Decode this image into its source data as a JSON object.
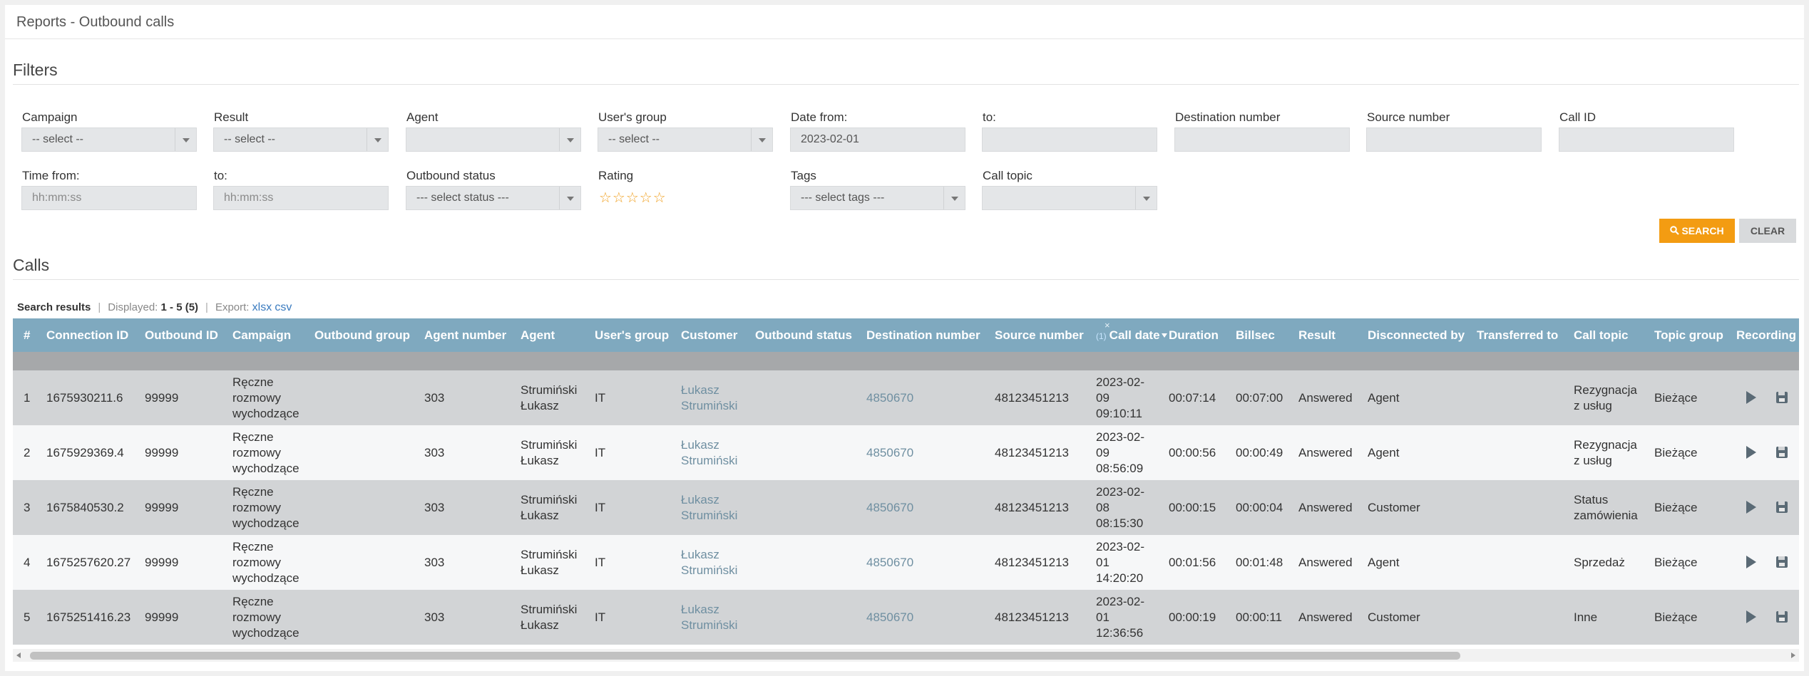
{
  "title": "Reports - Outbound calls",
  "filters": {
    "heading": "Filters",
    "campaign": {
      "label": "Campaign",
      "value": "-- select --"
    },
    "result": {
      "label": "Result",
      "value": "-- select --"
    },
    "agent": {
      "label": "Agent",
      "value": ""
    },
    "users_group": {
      "label": "User's group",
      "value": "-- select --"
    },
    "date_from": {
      "label": "Date from:",
      "value": "2023-02-01"
    },
    "date_to": {
      "label": "to:",
      "value": ""
    },
    "destination_number": {
      "label": "Destination number",
      "value": ""
    },
    "source_number": {
      "label": "Source number",
      "value": ""
    },
    "call_id": {
      "label": "Call ID",
      "value": ""
    },
    "time_from": {
      "label": "Time from:",
      "placeholder": "hh:mm:ss"
    },
    "time_to": {
      "label": "to:",
      "placeholder": "hh:mm:ss"
    },
    "outbound_status": {
      "label": "Outbound status",
      "value": "--- select status ---"
    },
    "rating": {
      "label": "Rating",
      "stars": "☆☆☆☆☆",
      "value": 0,
      "max": 5
    },
    "tags": {
      "label": "Tags",
      "value": "--- select tags ---"
    },
    "call_topic": {
      "label": "Call topic",
      "value": ""
    },
    "search_button": "SEARCH",
    "clear_button": "CLEAR"
  },
  "calls": {
    "heading": "Calls",
    "search_results_label": "Search results",
    "displayed_label": "Displayed:",
    "displayed_value": "1 - 5 (5)",
    "export_label": "Export:",
    "export_xlsx": "xlsx",
    "export_csv": "csv",
    "sort_indicator": "(1)",
    "sort_clear": "×",
    "columns": [
      "#",
      "Connection ID",
      "Outbound ID",
      "Campaign",
      "Outbound group",
      "Agent number",
      "Agent",
      "User's group",
      "Customer",
      "Outbound status",
      "Destination number",
      "Source number",
      "Call date",
      "Duration",
      "Billsec",
      "Result",
      "Disconnected by",
      "Transferred to",
      "Call topic",
      "Topic group",
      "Recording"
    ],
    "rows": [
      {
        "num": "1",
        "connection_id": "1675930211.6",
        "outbound_id": "99999",
        "campaign": [
          "Ręczne",
          "rozmowy",
          "wychodzące"
        ],
        "outbound_group": "",
        "agent_number": "303",
        "agent": [
          "Strumiński",
          "Łukasz"
        ],
        "users_group": "IT",
        "customer": [
          "Łukasz",
          "Strumiński"
        ],
        "outbound_status": "",
        "destination_number": "4850670",
        "source_number": "48123451213",
        "call_date": [
          "2023-02-",
          "09",
          "09:10:11"
        ],
        "duration": "00:07:14",
        "billsec": "00:07:00",
        "result": "Answered",
        "disconnected_by": "Agent",
        "transferred_to": "",
        "call_topic": [
          "Rezygnacja",
          "z usług"
        ],
        "topic_group": "Bieżące"
      },
      {
        "num": "2",
        "connection_id": "1675929369.4",
        "outbound_id": "99999",
        "campaign": [
          "Ręczne",
          "rozmowy",
          "wychodzące"
        ],
        "outbound_group": "",
        "agent_number": "303",
        "agent": [
          "Strumiński",
          "Łukasz"
        ],
        "users_group": "IT",
        "customer": [
          "Łukasz",
          "Strumiński"
        ],
        "outbound_status": "",
        "destination_number": "4850670",
        "source_number": "48123451213",
        "call_date": [
          "2023-02-",
          "09",
          "08:56:09"
        ],
        "duration": "00:00:56",
        "billsec": "00:00:49",
        "result": "Answered",
        "disconnected_by": "Agent",
        "transferred_to": "",
        "call_topic": [
          "Rezygnacja",
          "z usług"
        ],
        "topic_group": "Bieżące"
      },
      {
        "num": "3",
        "connection_id": "1675840530.2",
        "outbound_id": "99999",
        "campaign": [
          "Ręczne",
          "rozmowy",
          "wychodzące"
        ],
        "outbound_group": "",
        "agent_number": "303",
        "agent": [
          "Strumiński",
          "Łukasz"
        ],
        "users_group": "IT",
        "customer": [
          "Łukasz",
          "Strumiński"
        ],
        "outbound_status": "",
        "destination_number": "4850670",
        "source_number": "48123451213",
        "call_date": [
          "2023-02-",
          "08",
          "08:15:30"
        ],
        "duration": "00:00:15",
        "billsec": "00:00:04",
        "result": "Answered",
        "disconnected_by": "Customer",
        "transferred_to": "",
        "call_topic": [
          "Status",
          "zamówienia"
        ],
        "topic_group": "Bieżące"
      },
      {
        "num": "4",
        "connection_id": "1675257620.27",
        "outbound_id": "99999",
        "campaign": [
          "Ręczne",
          "rozmowy",
          "wychodzące"
        ],
        "outbound_group": "",
        "agent_number": "303",
        "agent": [
          "Strumiński",
          "Łukasz"
        ],
        "users_group": "IT",
        "customer": [
          "Łukasz",
          "Strumiński"
        ],
        "outbound_status": "",
        "destination_number": "4850670",
        "source_number": "48123451213",
        "call_date": [
          "2023-02-",
          "01",
          "14:20:20"
        ],
        "duration": "00:01:56",
        "billsec": "00:01:48",
        "result": "Answered",
        "disconnected_by": "Agent",
        "transferred_to": "",
        "call_topic": [
          "Sprzedaż"
        ],
        "topic_group": "Bieżące"
      },
      {
        "num": "5",
        "connection_id": "1675251416.23",
        "outbound_id": "99999",
        "campaign": [
          "Ręczne",
          "rozmowy",
          "wychodzące"
        ],
        "outbound_group": "",
        "agent_number": "303",
        "agent": [
          "Strumiński",
          "Łukasz"
        ],
        "users_group": "IT",
        "customer": [
          "Łukasz",
          "Strumiński"
        ],
        "outbound_status": "",
        "destination_number": "4850670",
        "source_number": "48123451213",
        "call_date": [
          "2023-02-",
          "01",
          "12:36:56"
        ],
        "duration": "00:00:19",
        "billsec": "00:00:11",
        "result": "Answered",
        "disconnected_by": "Customer",
        "transferred_to": "",
        "call_topic": [
          "Inne"
        ],
        "topic_group": "Bieżące"
      }
    ]
  },
  "colors": {
    "accent": "#f39c12",
    "table_header": "#7fa9bf",
    "link": "#3a7bbf"
  }
}
